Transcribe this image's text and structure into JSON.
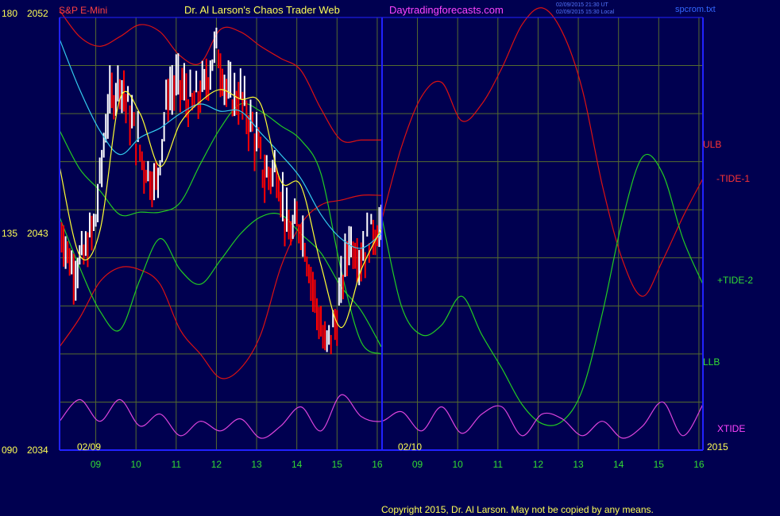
{
  "header": {
    "instrument": "S&P E-Mini",
    "title": "Dr. Al Larson's Chaos Trader Web",
    "site": "Daytradingforecasts.com",
    "timestamp_utc": "02/09/2015 21:30 UT",
    "timestamp_local": "02/09/2015 15:30 Local",
    "file": "spcrom.txt"
  },
  "footer": {
    "copyright": "Copyright 2015, Dr. Al Larson. May not be copied by any means."
  },
  "colors": {
    "background": "#000050",
    "axis": "#2222ff",
    "grid": "#556b2f",
    "price_up": "#ffffff",
    "price_down": "#ff0000",
    "ulb_llb": "#dd1111",
    "green": "#22cc22",
    "magenta": "#dd44dd",
    "yellow": "#ffff33",
    "cyan": "#33ccee",
    "label_yellow": "#ffff55",
    "label_green": "#33dd33"
  },
  "chart_data": {
    "type": "line",
    "yaxis": {
      "labels": [
        {
          "left": "180",
          "right": "2052"
        },
        {
          "left": "135",
          "right": "2043"
        },
        {
          "left": "090",
          "right": "2034"
        }
      ],
      "ylim": [
        2034,
        2052
      ]
    },
    "xaxis": {
      "dates": [
        "02/09",
        "02/10"
      ],
      "year": "2015",
      "hour_ticks": [
        "09",
        "10",
        "11",
        "12",
        "13",
        "14",
        "15",
        "16",
        "09",
        "10",
        "11",
        "12",
        "13",
        "14",
        "15",
        "16"
      ]
    },
    "series_labels": {
      "ulb": "ULB",
      "tide1": "-TIDE-1",
      "tide2": "+TIDE-2",
      "llb": "LLB",
      "xtide": "XTIDE"
    },
    "series": [
      {
        "key": "ulb",
        "color": "#dd1111",
        "x": [
          8.0,
          8.5,
          9.0,
          9.5,
          10.0,
          10.5,
          11.0,
          11.5,
          12.0,
          12.5,
          13.0,
          13.5,
          14.0,
          14.5,
          15.0,
          15.5,
          16.0
        ],
        "y": [
          2052.3,
          2051.2,
          2050.8,
          2051.2,
          2051.7,
          2051.4,
          2050.4,
          2050.1,
          2051.5,
          2051.4,
          2050.8,
          2050.3,
          2049.8,
          2048.2,
          2046.9,
          2046.9,
          2046.9
        ]
      },
      {
        "key": "llb",
        "color": "#dd1111",
        "x": [
          8.0,
          8.5,
          9.0,
          9.5,
          10.0,
          10.5,
          11.0,
          11.5,
          12.0,
          12.5,
          13.0,
          13.5,
          14.0,
          14.5,
          15.0,
          15.5,
          16.0
        ],
        "y": [
          2038.3,
          2039.5,
          2041.0,
          2041.6,
          2041.5,
          2040.9,
          2039.0,
          2038.0,
          2037.0,
          2037.4,
          2038.8,
          2041.6,
          2043.4,
          2044.2,
          2044.4,
          2044.6,
          2044.6
        ]
      },
      {
        "key": "upper_green",
        "color": "#22cc22",
        "x": [
          8.0,
          8.5,
          9.0,
          9.5,
          10.0,
          10.5,
          11.0,
          11.5,
          12.0,
          12.5,
          13.0,
          13.5,
          14.0,
          14.5,
          15.0,
          15.5,
          16.0
        ],
        "y": [
          2047.3,
          2045.7,
          2044.8,
          2043.8,
          2043.9,
          2043.9,
          2044.3,
          2045.9,
          2047.4,
          2048.4,
          2048.1,
          2047.5,
          2046.9,
          2045.5,
          2041.5,
          2038.5,
          2038.0
        ]
      },
      {
        "key": "lower_green",
        "color": "#22cc22",
        "x": [
          8.0,
          8.5,
          9.0,
          9.5,
          10.0,
          10.5,
          11.0,
          11.5,
          12.0,
          12.5,
          13.0,
          13.5,
          14.0,
          14.5,
          15.0,
          15.5,
          16.0
        ],
        "y": [
          2043.7,
          2041.6,
          2039.8,
          2039.0,
          2041.1,
          2042.8,
          2041.5,
          2040.9,
          2041.9,
          2043.0,
          2043.7,
          2043.8,
          2043.0,
          2042.2,
          2040.8,
          2039.8,
          2038.3
        ]
      },
      {
        "key": "tide1",
        "color": "#dd1111",
        "x": [
          16.0,
          16.5,
          17.0,
          17.5,
          18.0,
          18.5,
          19.0,
          19.5,
          20.0,
          20.5,
          21.0,
          21.5,
          22.0,
          22.5,
          23.0,
          23.5,
          24.0
        ],
        "y": [
          2043.5,
          2046.6,
          2048.7,
          2049.3,
          2047.7,
          2048.4,
          2049.9,
          2051.7,
          2052.4,
          2051.4,
          2049.0,
          2045.0,
          2041.9,
          2040.4,
          2041.9,
          2043.7,
          2045.3
        ]
      },
      {
        "key": "tide2",
        "color": "#22cc22",
        "x": [
          16.0,
          16.5,
          17.0,
          17.5,
          18.0,
          18.5,
          19.0,
          19.5,
          20.0,
          20.5,
          21.0,
          21.5,
          22.0,
          22.5,
          23.0,
          23.5,
          24.0
        ],
        "y": [
          2043.8,
          2040.0,
          2038.8,
          2039.2,
          2040.4,
          2038.8,
          2037.4,
          2035.9,
          2035.1,
          2035.2,
          2036.5,
          2039.7,
          2043.6,
          2046.2,
          2045.5,
          2042.8,
          2040.9
        ]
      },
      {
        "key": "xtide",
        "color": "#dd44dd",
        "x": [
          8.0,
          8.5,
          9.0,
          9.5,
          10.0,
          10.5,
          11.0,
          11.5,
          12.0,
          12.5,
          13.0,
          13.5,
          14.0,
          14.5,
          15.0,
          15.5,
          16.0,
          16.5,
          17.0,
          17.5,
          18.0,
          18.5,
          19.0,
          19.5,
          20.0,
          20.5,
          21.0,
          21.5,
          22.0,
          22.5,
          23.0,
          23.5,
          24.0
        ],
        "y": [
          2035.2,
          2036.1,
          2035.2,
          2036.1,
          2035.0,
          2035.5,
          2034.6,
          2035.2,
          2034.8,
          2035.3,
          2034.5,
          2035.0,
          2035.8,
          2034.8,
          2036.3,
          2035.4,
          2035.2,
          2035.6,
          2034.8,
          2035.8,
          2034.7,
          2035.5,
          2035.8,
          2034.6,
          2035.5,
          2035.3,
          2034.6,
          2035.2,
          2034.5,
          2035.0,
          2036.0,
          2034.6,
          2035.9
        ]
      },
      {
        "key": "price_ma_yellow",
        "color": "#ffff33",
        "x": [
          8.0,
          8.5,
          9.0,
          9.5,
          10.0,
          10.5,
          11.0,
          11.5,
          12.0,
          12.5,
          13.0,
          13.5,
          14.0,
          14.5,
          15.0,
          15.5,
          16.0
        ],
        "y": [
          2045.8,
          2042.1,
          2043.1,
          2048.6,
          2048.0,
          2045.8,
          2047.6,
          2048.5,
          2049.0,
          2048.6,
          2048.4,
          2045.2,
          2045.0,
          2041.7,
          2039.1,
          2041.5,
          2043.2
        ]
      },
      {
        "key": "price_ma_cyan",
        "color": "#33ccee",
        "x": [
          8.0,
          8.5,
          9.0,
          9.5,
          10.0,
          10.5,
          11.0,
          11.5,
          12.0,
          12.5,
          13.0,
          13.5,
          14.0,
          14.5,
          15.0,
          15.5,
          16.0
        ],
        "y": [
          2051.1,
          2049.0,
          2047.3,
          2046.3,
          2047.0,
          2047.4,
          2048.0,
          2048.4,
          2048.1,
          2048.1,
          2047.2,
          2046.3,
          2045.3,
          2043.8,
          2042.8,
          2042.4,
          2043.0
        ]
      },
      {
        "key": "price",
        "color": "#ffffff",
        "x": [
          8.0,
          8.3,
          8.6,
          8.9,
          9.2,
          9.5,
          9.8,
          10.1,
          10.4,
          10.7,
          11.0,
          11.3,
          11.6,
          11.9,
          12.2,
          12.5,
          12.8,
          13.1,
          13.4,
          13.7,
          14.0,
          14.3,
          14.6,
          14.9,
          15.2,
          15.5,
          15.8,
          16.0
        ],
        "y": [
          2043.5,
          2041.6,
          2042.0,
          2043.6,
          2048.2,
          2049.5,
          2047.6,
          2045.9,
          2045.0,
          2048.9,
          2049.2,
          2048.3,
          2049.1,
          2050.8,
          2048.7,
          2048.7,
          2047.4,
          2045.4,
          2045.7,
          2042.9,
          2043.5,
          2040.8,
          2038.2,
          2039.5,
          2042.8,
          2042.1,
          2043.2,
          2043.2
        ]
      }
    ]
  }
}
